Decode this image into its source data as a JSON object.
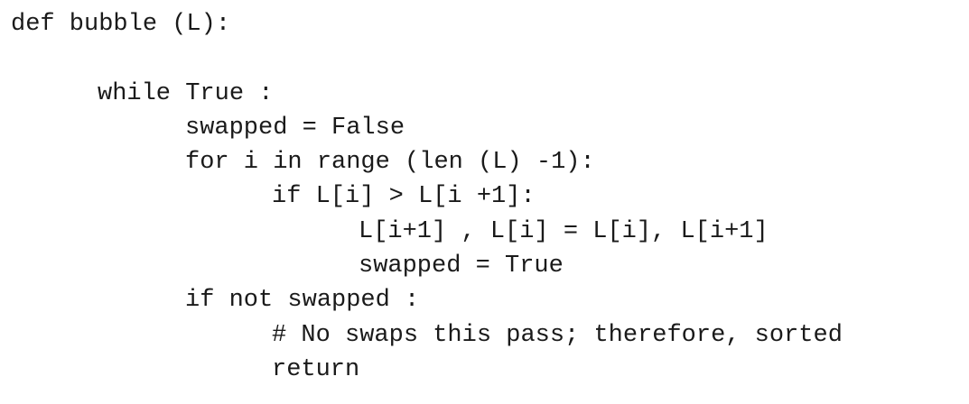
{
  "code": {
    "lines": [
      "def bubble (L):",
      "while True :",
      "swapped = False",
      "for i in range (len (L) -1):",
      "if L[i] > L[i +1]:",
      "L[i+1] , L[i] = L[i], L[i+1]",
      "swapped = True",
      "if not swapped :",
      "# No swaps this pass; therefore, sorted",
      "return"
    ]
  }
}
